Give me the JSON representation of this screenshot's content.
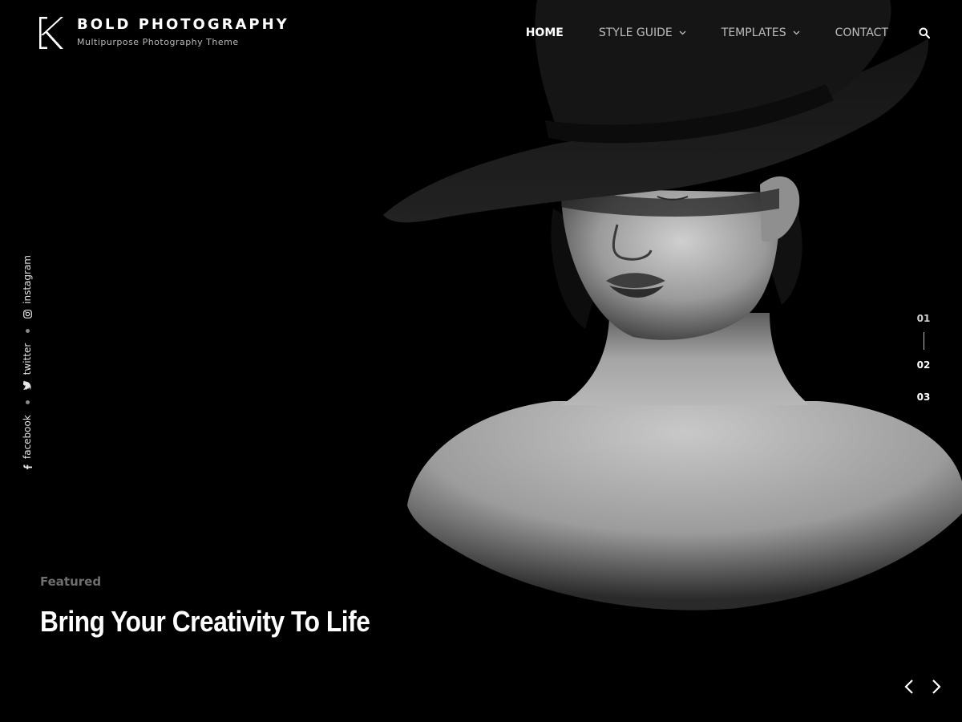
{
  "site": {
    "title": "BOLD PHOTOGRAPHY",
    "tagline": "Multipurpose Photography Theme",
    "logo_icon": "k-logo-icon"
  },
  "nav": {
    "items": [
      {
        "label": "HOME",
        "active": true
      },
      {
        "label": "STYLE GUIDE",
        "dropdown": true
      },
      {
        "label": "TEMPLATES",
        "dropdown": true
      },
      {
        "label": "CONTACT"
      }
    ],
    "search_icon": "search-icon"
  },
  "social": [
    {
      "label": "facebook",
      "icon": "facebook-icon"
    },
    {
      "label": "twitter",
      "icon": "twitter-icon"
    },
    {
      "label": "instagram",
      "icon": "instagram-icon"
    }
  ],
  "slider": {
    "indicators": [
      "01",
      "02",
      "03"
    ],
    "active_index": 0,
    "caption_label": "Featured",
    "caption_title": "Bring Your Creativity To Life",
    "prev_icon": "chevron-left-icon",
    "next_icon": "chevron-right-icon"
  },
  "colors": {
    "background": "#000000",
    "text": "#ffffff",
    "muted": "#6f6f6f"
  }
}
